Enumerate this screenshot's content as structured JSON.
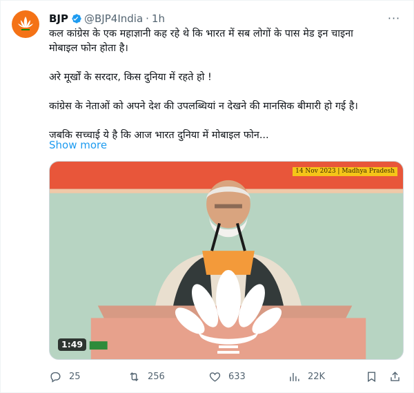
{
  "account": {
    "name": "BJP",
    "handle": "@BJP4India",
    "separator": "·",
    "time": "1h",
    "avatar_color": "#f47216",
    "verified_color": "#1d9bf0"
  },
  "tweet": {
    "lines": [
      "कल कांग्रेस के एक महाज्ञानी कह रहे थे कि भारत में सब लोगों के पास मेड इन चाइना",
      "मोबाइल फोन होता है।",
      "",
      "अरे मूर्खों के सरदार, किस दुनिया में रहते हो !",
      "",
      "कांग्रेस के नेताओं को अपने देश की उपलब्धियां न देखने की मानसिक बीमारी हो गई है।",
      "",
      "जबकि सच्चाई ये है कि आज भारत दुनिया में मोबाइल फोन..."
    ],
    "show_more": "Show more"
  },
  "media": {
    "stamp": "14 Nov 2023 | Madhya Pradesh",
    "duration": "1:49",
    "stamp_color": "#f5c518"
  },
  "actions": {
    "replies": "25",
    "retweets": "256",
    "likes": "633",
    "views": "22K"
  },
  "icons": {
    "more": "more-horizontal-icon",
    "verified": "verified-badge-icon",
    "reply": "reply-icon",
    "retweet": "retweet-icon",
    "like": "heart-icon",
    "views": "views-chart-icon",
    "bookmark": "bookmark-icon",
    "share": "share-icon"
  }
}
